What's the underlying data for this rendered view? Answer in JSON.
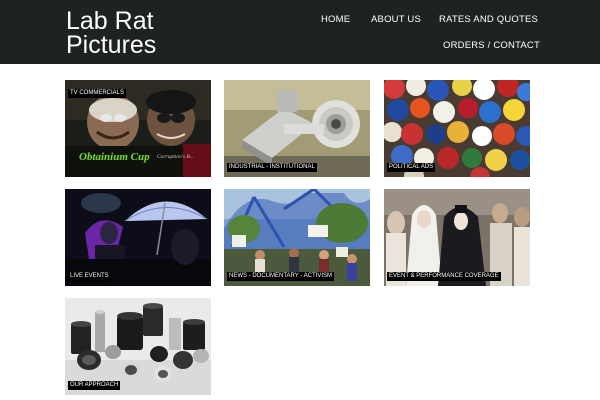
{
  "site": {
    "title_line1": "Lab Rat",
    "title_line2": "Pictures"
  },
  "nav": {
    "home": "HOME",
    "about": "ABOUT US",
    "rates": "RATES AND QUOTES",
    "orders": "ORDERS / CONTACT"
  },
  "portfolio": {
    "tiles": [
      {
        "label": "TV COMMERCIALS",
        "overlay_title": "Obtainium Cup",
        "overlay_sub": "Corruption's B..."
      },
      {
        "label": "INDUSTRIAL - INSTITUTIONAL"
      },
      {
        "label": "POLITICAL ADS"
      },
      {
        "label": "LIVE EVENTS"
      },
      {
        "label": "NEWS - DOCUMENTARY - ACTIVISM"
      },
      {
        "label": "EVENT & PERFORMANCE COVERAGE"
      },
      {
        "label": "OUR APPROACH"
      }
    ]
  },
  "colors": {
    "header_bg": "#1f2223",
    "page_bg": "#ffffff",
    "label_bg": "#000000",
    "label_text": "#ffffff"
  }
}
